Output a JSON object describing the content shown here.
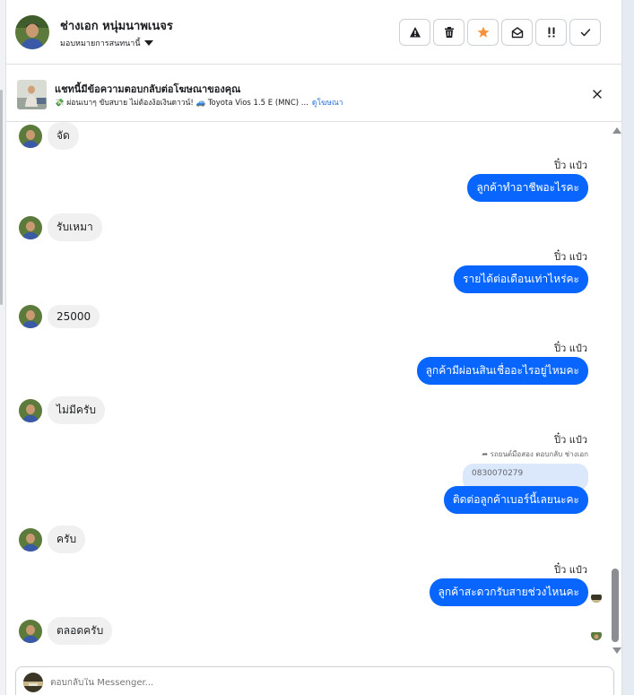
{
  "header": {
    "name": "ช่างเอก หนุ่มนาพเนจร",
    "assign_label": "มอบหมายการสนทนานี้"
  },
  "ad_banner": {
    "title": "แชทนี้มีข้อความตอบกลับต่อโฆษณาของคุณ",
    "snippet": "💸 ผ่อนเบาๆ ขับสบาย ไม่ต้องง้อเงินดาวน์! 🚙 Toyota Vios 1.5 E (MNC) ...",
    "link": "ดูโฆษณา"
  },
  "messages": [
    {
      "direction": "in",
      "text": "จัด"
    },
    {
      "direction": "out",
      "sender": "ปิ๋ว แป๋ว",
      "text": "ลูกค้าทำอาชีพอะไรคะ"
    },
    {
      "direction": "in",
      "text": "รับเหมา"
    },
    {
      "direction": "out",
      "sender": "ปิ๋ว แป๋ว",
      "text": "รายได้ต่อเดือนเท่าไหร่คะ"
    },
    {
      "direction": "in",
      "text": "25000"
    },
    {
      "direction": "out",
      "sender": "ปิ๋ว แป๋ว",
      "text": "ลูกค้ามีผ่อนสินเชื่ออะไรอยู่ไหมคะ"
    },
    {
      "direction": "in",
      "text": "ไม่มีครับ"
    },
    {
      "direction": "out",
      "sender": "ปิ๋ว แป๋ว",
      "reply_meta": "รถยนต์มือสอง ตอบกลับ ช่างเอก",
      "quoted": "0830070279",
      "text": "ติดต่อลูกค้าเบอร์นี้เลยนะคะ"
    },
    {
      "direction": "in",
      "text": "ครับ"
    },
    {
      "direction": "out",
      "sender": "ปิ๋ว แป๋ว",
      "text": "ลูกค้าสะดวกรับสายช่วงไหนคะ"
    },
    {
      "direction": "in",
      "text": "ตลอดครับ"
    }
  ],
  "composer": {
    "placeholder": "ตอบกลับใน Messenger..."
  },
  "colors": {
    "outgoing_bubble": "#0866ff",
    "incoming_bubble": "#f0f0f0",
    "star": "#f7923b",
    "link": "#216fdb"
  },
  "icons": [
    "warning-icon",
    "trash-icon",
    "star-icon",
    "envelope-open-icon",
    "important-icon",
    "check-icon",
    "close-icon",
    "caret-down-icon"
  ]
}
